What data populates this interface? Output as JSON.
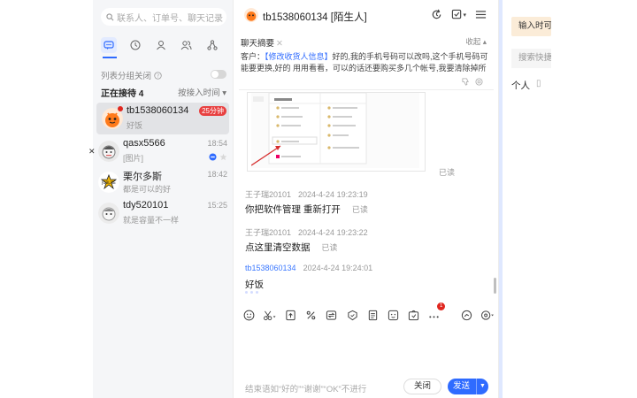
{
  "colors": {
    "accent": "#2f6bff",
    "badge_red": "#e84040",
    "selected_bg": "#e2e3e6"
  },
  "left": {
    "search_placeholder": "联系人、订单号、聊天记录",
    "group_label": "列表分组关闭",
    "serving_label": "正在接待 4",
    "sort_label": "按接入时间",
    "conversations": [
      {
        "name": "tb1538060134",
        "message": "好饭",
        "badge": "25分钟"
      },
      {
        "name": "qasx5566",
        "message": "[图片]",
        "time": "18:54"
      },
      {
        "name": "栗尔多斯",
        "message": "都是可以的好",
        "time": "18:42"
      },
      {
        "name": "tdy520101",
        "message": "就是容量不一样",
        "time": "15:25"
      }
    ]
  },
  "chat": {
    "title": "tb1538060134",
    "title_suffix": "[陌生人]",
    "summary_title": "聊天摘要",
    "summary_collapse": "收起",
    "summary_prefix": "客户：",
    "summary_link": "【修改收货人信息】",
    "summary_text": "好的,我的手机号码可以改吗,这个手机号码可能要更换,好的 用用看看，可以的话还要购买多几个帐号,我要清除掉所有商品重新...",
    "read_label": "已读",
    "messages": [
      {
        "sender": "王子瑞20101",
        "time": "2024-4-24 19:23:19",
        "text": "你把软件管理 重新打开",
        "read": "已读"
      },
      {
        "sender": "王子瑞20101",
        "time": "2024-4-24 19:23:22",
        "text": "点这里清空数据",
        "read": "已读"
      },
      {
        "sender": "tb1538060134",
        "time": "2024-4-24 19:24:01",
        "text": "好饭"
      }
    ],
    "input_placeholder": "结束语如“好的”“谢谢”“OK”不进行",
    "close_label": "关闭",
    "send_label": "发送",
    "toolbar_badge": "1"
  },
  "right": {
    "input_time_label": "输入时可",
    "search_placeholder": "搜索快捷",
    "personal_label": "个人"
  }
}
